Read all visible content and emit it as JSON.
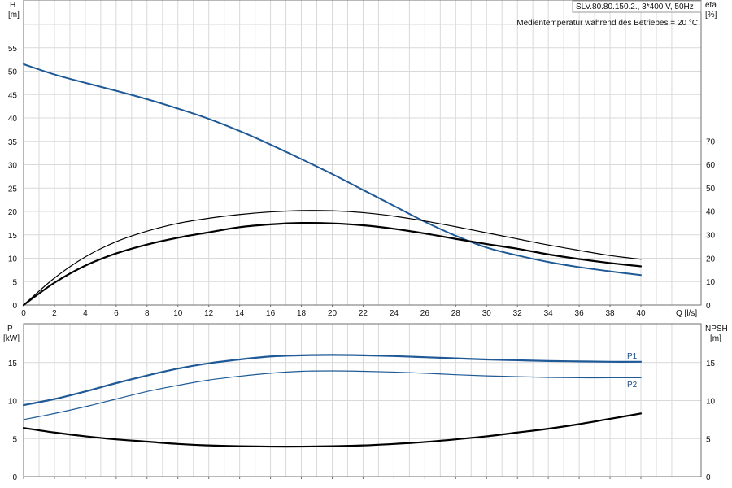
{
  "chart_data": [
    {
      "type": "line",
      "title": "SLV.80.80.150.2., 3*400 V, 50Hz",
      "subtitle": "Medientemperatur während des Betriebes = 20 °C",
      "xlabel": "Q [l/s]",
      "xlabel_unit": "Q [l/s]",
      "ylabel": "H",
      "ylabel_unit": "[m]",
      "y2label": "eta",
      "y2label_unit": "[%]",
      "xlim": [
        0,
        40
      ],
      "ylim": [
        0,
        60
      ],
      "y2lim": [
        0,
        130
      ],
      "grid": true,
      "x_ticks": [
        "0",
        "2",
        "4",
        "6",
        "8",
        "10",
        "12",
        "14",
        "16",
        "18",
        "20",
        "22",
        "24",
        "26",
        "28",
        "30",
        "32",
        "34",
        "36",
        "38",
        "40"
      ],
      "y_ticks": [
        "0",
        "5",
        "10",
        "15",
        "20",
        "25",
        "30",
        "35",
        "40",
        "45",
        "50",
        "55"
      ],
      "y2_ticks": [
        "0",
        "10",
        "20",
        "30",
        "40",
        "50",
        "60",
        "70"
      ],
      "series": [
        {
          "axis": "left",
          "color": "#1f5a96",
          "x": [
            0,
            2,
            4,
            6,
            8,
            10,
            12,
            14,
            16,
            18,
            20,
            22,
            24,
            26,
            28,
            30,
            32,
            34,
            36,
            38,
            40
          ],
          "y": [
            51.5,
            49.3,
            47.5,
            45.8,
            44.0,
            42.0,
            39.8,
            37.2,
            34.3,
            31.2,
            28.0,
            24.6,
            21.2,
            17.8,
            14.8,
            12.3,
            10.6,
            9.2,
            8.1,
            7.2,
            6.4
          ]
        },
        {
          "axis": "right",
          "color": "#000000",
          "width": 1.2,
          "x": [
            0,
            2,
            4,
            6,
            8,
            10,
            12,
            14,
            16,
            18,
            20,
            22,
            24,
            26,
            28,
            30,
            32,
            34,
            36,
            38,
            40
          ],
          "y": [
            0,
            11.5,
            20.5,
            27.0,
            31.5,
            34.8,
            37.0,
            38.6,
            39.7,
            40.3,
            40.2,
            39.4,
            37.9,
            35.8,
            33.4,
            30.8,
            28.2,
            25.6,
            23.3,
            21.1,
            19.5
          ]
        },
        {
          "axis": "right",
          "color": "#000000",
          "width": 2.2,
          "x": [
            0,
            2,
            4,
            6,
            8,
            10,
            12,
            14,
            16,
            18,
            20,
            22,
            24,
            26,
            28,
            30,
            32,
            34,
            36,
            38,
            40
          ],
          "y": [
            0,
            9.5,
            16.8,
            22.0,
            25.8,
            28.7,
            31.0,
            33.2,
            34.4,
            35.0,
            34.8,
            34.0,
            32.5,
            30.5,
            28.2,
            26.0,
            24.0,
            21.6,
            19.6,
            17.9,
            16.5
          ]
        }
      ]
    },
    {
      "type": "line",
      "xlim": [
        0,
        40
      ],
      "ylabel": "P",
      "ylabel_unit": "[kW]",
      "y2label": "NPSH",
      "y2label_unit": "[m]",
      "ylim": [
        0,
        20
      ],
      "y2lim": [
        0,
        20
      ],
      "grid": true,
      "y_ticks": [
        "0",
        "5",
        "10",
        "15"
      ],
      "y2_ticks": [
        "0",
        "5",
        "10",
        "15"
      ],
      "series": [
        {
          "name": "P1",
          "axis": "left",
          "color": "#1f5a96",
          "width": 2.2,
          "x": [
            0,
            2,
            4,
            6,
            8,
            10,
            12,
            14,
            16,
            18,
            20,
            22,
            24,
            26,
            28,
            30,
            32,
            34,
            36,
            38,
            40
          ],
          "y": [
            9.4,
            10.2,
            11.2,
            12.3,
            13.3,
            14.2,
            14.9,
            15.4,
            15.8,
            15.95,
            16.0,
            15.95,
            15.85,
            15.7,
            15.55,
            15.4,
            15.3,
            15.2,
            15.15,
            15.1,
            15.1
          ]
        },
        {
          "name": "P2",
          "axis": "left",
          "color": "#1f5a96",
          "width": 1.2,
          "x": [
            0,
            2,
            4,
            6,
            8,
            10,
            12,
            14,
            16,
            18,
            20,
            22,
            24,
            26,
            28,
            30,
            32,
            34,
            36,
            38,
            40
          ],
          "y": [
            7.5,
            8.3,
            9.2,
            10.2,
            11.2,
            12.0,
            12.7,
            13.2,
            13.6,
            13.85,
            13.9,
            13.85,
            13.75,
            13.6,
            13.4,
            13.25,
            13.15,
            13.05,
            13.0,
            13.0,
            13.0
          ]
        },
        {
          "axis": "right",
          "color": "#000000",
          "width": 2.2,
          "x": [
            0,
            2,
            4,
            6,
            8,
            10,
            12,
            14,
            16,
            18,
            20,
            22,
            24,
            26,
            28,
            30,
            32,
            34,
            36,
            38,
            40
          ],
          "y": [
            6.4,
            5.8,
            5.3,
            4.9,
            4.6,
            4.3,
            4.1,
            4.0,
            3.95,
            3.95,
            4.0,
            4.1,
            4.3,
            4.55,
            4.9,
            5.3,
            5.8,
            6.3,
            6.9,
            7.6,
            8.3
          ]
        }
      ]
    }
  ]
}
